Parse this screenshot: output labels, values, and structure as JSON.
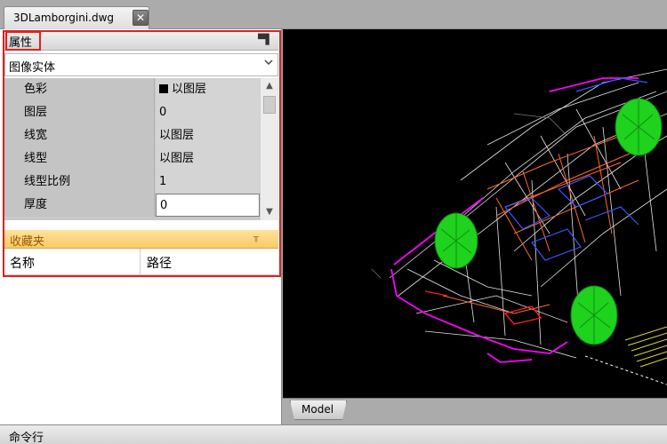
{
  "document_tab": {
    "label": "3DLamborgini.dwg",
    "close_glyph": "✕"
  },
  "properties_panel": {
    "title": "属性",
    "pin_glyph": "⊓",
    "entity_type": "图像实体",
    "rows": [
      {
        "name": "色彩",
        "value": "以图层",
        "swatch": "#000000"
      },
      {
        "name": "图层",
        "value": "0"
      },
      {
        "name": "线宽",
        "value": "以图层"
      },
      {
        "name": "线型",
        "value": "以图层"
      },
      {
        "name": "线型比例",
        "value": "1"
      },
      {
        "name": "厚度",
        "value": "0"
      }
    ]
  },
  "favorites_panel": {
    "title": "收藏夹",
    "columns": {
      "name": "名称",
      "path": "路径"
    }
  },
  "canvas": {
    "background": "#000000",
    "layout_tab": "Model"
  },
  "command_bar": {
    "title": "命令行"
  },
  "colors": {
    "highlight": "#e02020",
    "favorites": "#f7c96a",
    "wheel": "#22dd22",
    "body": "#ff00ff"
  }
}
